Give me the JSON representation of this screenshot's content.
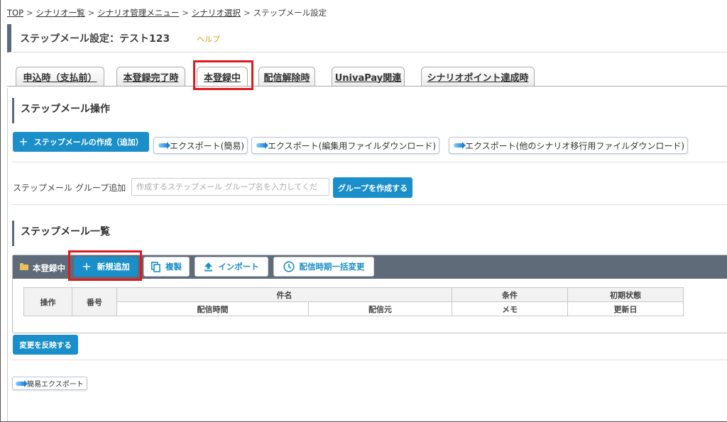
{
  "breadcrumb": {
    "items": [
      "TOP",
      "シナリオ一覧",
      "シナリオ管理メニュー",
      "シナリオ選択",
      "ステップメール設定"
    ],
    "separator": ">"
  },
  "page": {
    "title": "ステップメール設定：テスト123",
    "help": "ヘルプ"
  },
  "tabs": [
    {
      "label": "申込時（支払前）"
    },
    {
      "label": "本登録完了時"
    },
    {
      "label": "本登録中",
      "active": true
    },
    {
      "label": "配信解除時"
    },
    {
      "label": "UnivaPay関連"
    },
    {
      "label": "シナリオポイント達成時"
    }
  ],
  "operations": {
    "heading": "ステップメール操作",
    "create_button": "ステップメールの作成（追加）",
    "exports": [
      "エクスポート(簡易)",
      "エクスポート(編集用ファイルダウンロード)",
      "エクスポート(他のシナリオ移行用ファイルダウンロード)"
    ]
  },
  "group": {
    "label": "ステップメール グループ追加",
    "placeholder": "作成するステップメール グループ名を入力してくだ",
    "create_button": "グループを作成する"
  },
  "list": {
    "heading": "ステップメール一覧",
    "group_name": "本登録中",
    "buttons": {
      "add": "新規追加",
      "copy": "複製",
      "import": "インポート",
      "bulk_change": "配信時期一括変更"
    },
    "table": {
      "headers": [
        "操作",
        "番号",
        "件名",
        "条件",
        "初期状態"
      ],
      "subheaders": [
        "配信時間",
        "配信元",
        "メモ",
        "更新日"
      ]
    }
  },
  "footer": {
    "apply_button": "変更を反映する",
    "simple_export": "簡易エクスポート"
  },
  "colors": {
    "accent": "#1b8fc9",
    "highlight": "#e0191f",
    "header_bar": "#5f6b78",
    "help": "#d4a017"
  }
}
